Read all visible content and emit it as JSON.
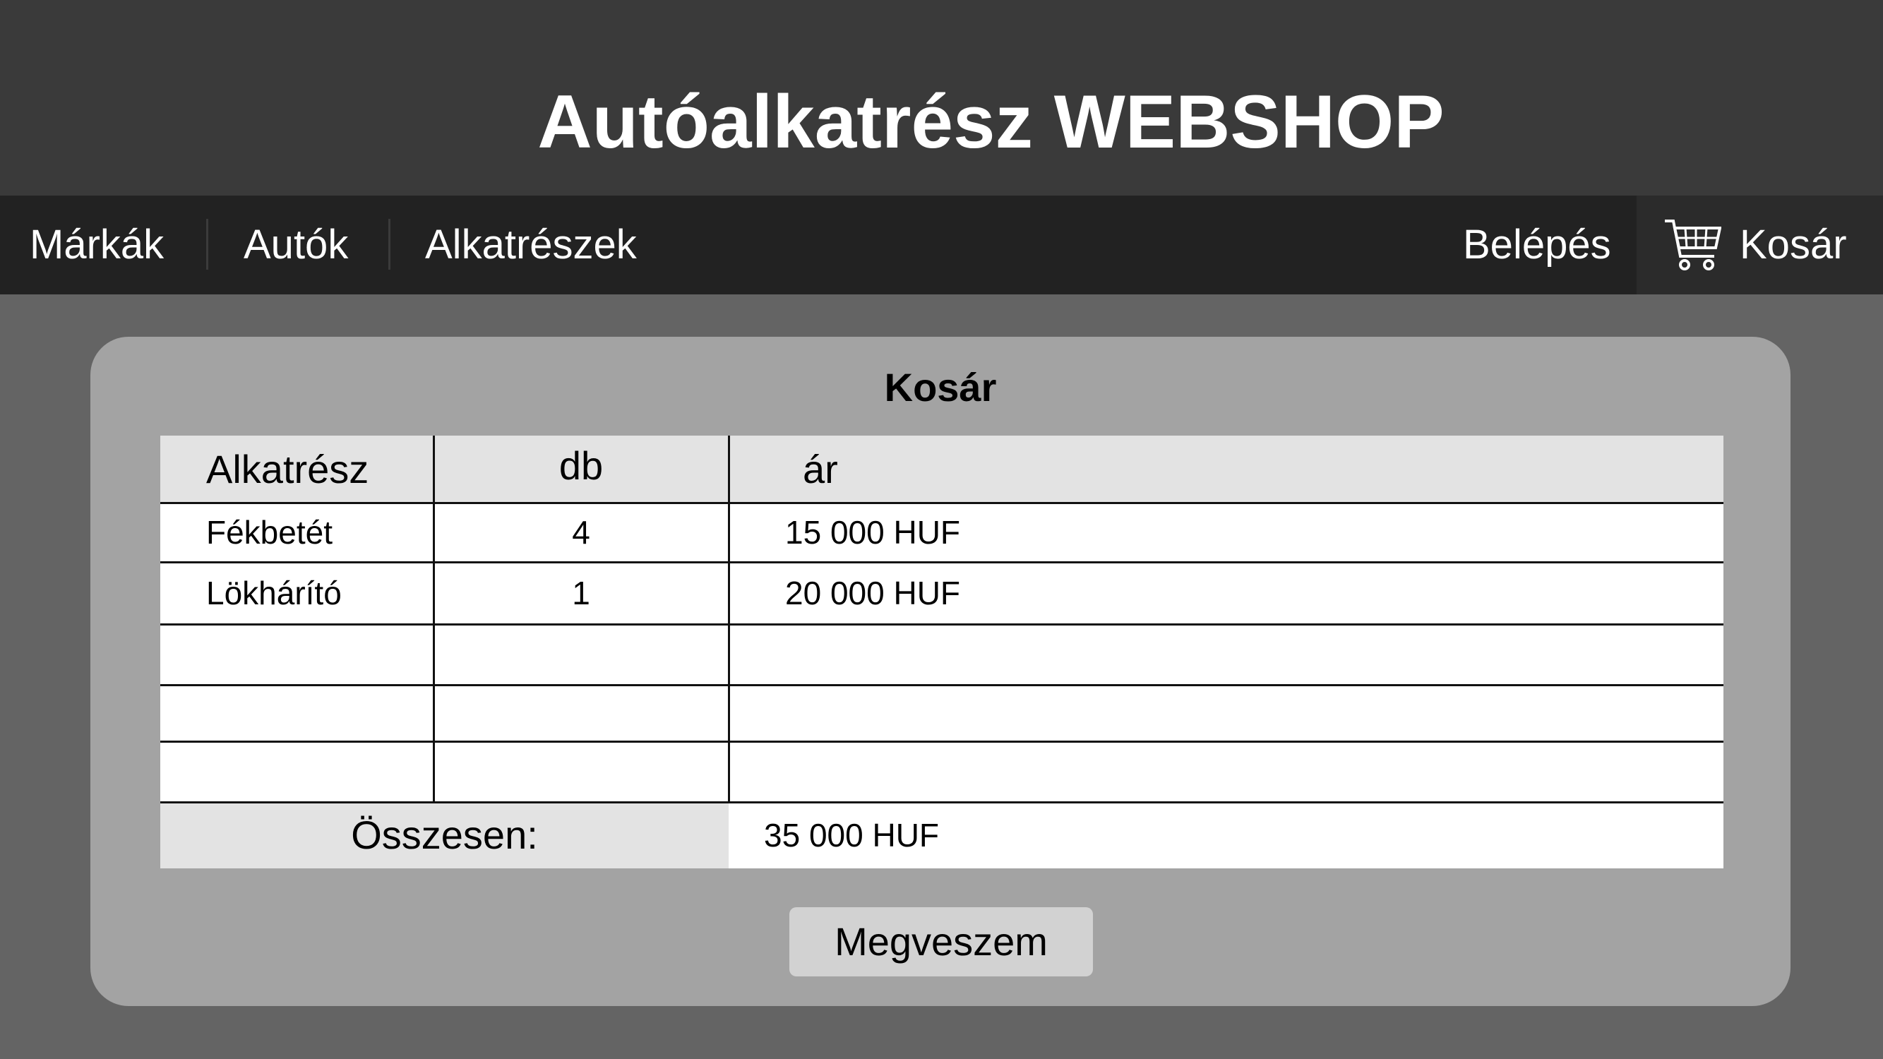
{
  "header": {
    "title": "Autóalkatrész WEBSHOP"
  },
  "nav": {
    "left_items": [
      "Márkák",
      "Autók",
      "Alkatrészek"
    ],
    "login": "Belépés",
    "cart": "Kosár",
    "cart_icon": "cart-icon"
  },
  "cart_panel": {
    "title": "Kosár",
    "columns": [
      "Alkatrész",
      "db",
      "ár"
    ],
    "rows": [
      {
        "part": "Fékbetét",
        "qty": "4",
        "price": "15 000 HUF"
      },
      {
        "part": "Lökhárító",
        "qty": "1",
        "price": "20 000 HUF"
      },
      {
        "part": "",
        "qty": "",
        "price": ""
      },
      {
        "part": "",
        "qty": "",
        "price": ""
      },
      {
        "part": "",
        "qty": "",
        "price": ""
      }
    ],
    "total_label": "Összesen:",
    "total_value": "35 000 HUF",
    "buy_button": "Megveszem"
  },
  "colors": {
    "header_bg": "#3a3a3a",
    "nav_bg": "#222222",
    "page_bg": "#646464",
    "panel_bg": "#a3a3a3",
    "table_header_bg": "#e3e3e3"
  }
}
